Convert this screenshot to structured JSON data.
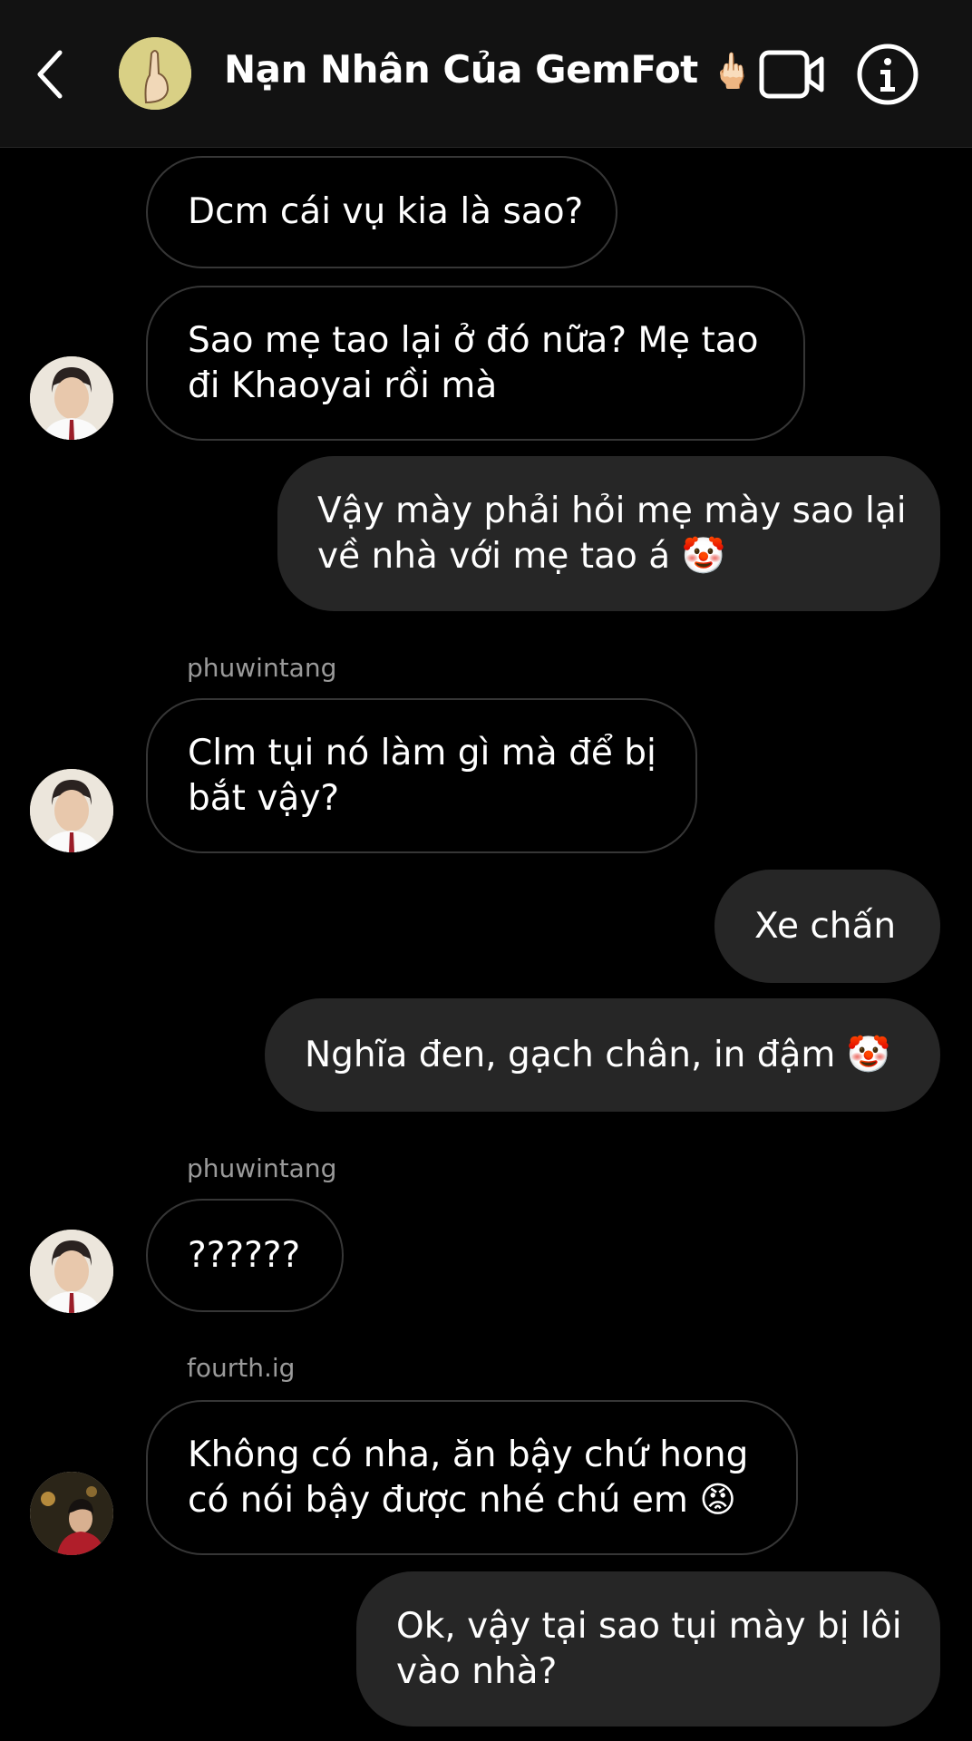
{
  "header": {
    "title": "Nạn Nhân Của GemFot",
    "title_emoji": "🖕🏻",
    "back_icon": "chevron-left-icon",
    "video_icon": "video-camera-icon",
    "info_icon": "info-icon"
  },
  "messages": [
    {
      "side": "in",
      "text": "Dcm cái vụ kia là sao?"
    },
    {
      "side": "in",
      "text": "Sao mẹ tao lại ở đó nữa? Mẹ tao\nđi Khaoyai rồi mà"
    },
    {
      "side": "out",
      "text": "Vậy mày phải hỏi mẹ mày sao lại\nvề nhà với mẹ tao á 🤡"
    },
    {
      "side": "in",
      "sender": "phuwintang",
      "text": "Clm tụi nó làm gì mà để bị\nbắt vậy?"
    },
    {
      "side": "out",
      "text": "Xe chấn"
    },
    {
      "side": "out",
      "text": "Nghĩa đen, gạch chân, in đậm 🤡"
    },
    {
      "side": "in",
      "sender": "phuwintang",
      "text": "??????"
    },
    {
      "side": "in",
      "sender": "fourth.ig",
      "text": "Không có nha, ăn bậy chứ hong\ncó nói bậy được nhé chú em 😡"
    },
    {
      "side": "out",
      "text": "Ok, vậy tại sao tụi mày bị lôi\nvào nhà?"
    }
  ],
  "colors": {
    "background": "#000000",
    "header_bg": "#121212",
    "incoming_border": "#363636",
    "outgoing_bg": "#262626",
    "sender_text": "#9a9a9a"
  }
}
